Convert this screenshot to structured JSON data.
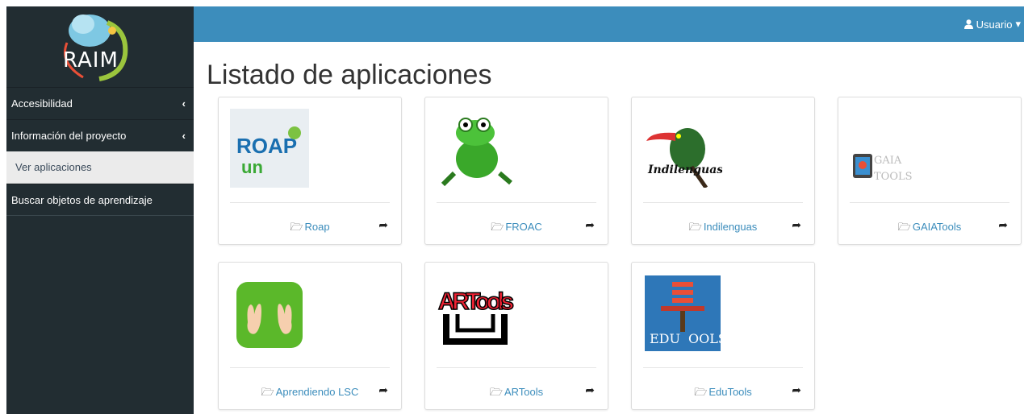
{
  "brand": {
    "logo_text": "RAIM"
  },
  "sidebar": {
    "items": [
      {
        "label": "Accesibilidad",
        "chevron": "‹"
      },
      {
        "label": "Información del proyecto",
        "chevron": "‹"
      },
      {
        "label": "Ver aplicaciones",
        "active": true
      },
      {
        "label": "Buscar objetos de aprendizaje"
      }
    ]
  },
  "header": {
    "user_label": "Usuario",
    "user_icon": "user-icon",
    "caret": "▾"
  },
  "main": {
    "title": "Listado de aplicaciones",
    "apps": [
      {
        "name": "Roap",
        "logo_text": "ROAP un"
      },
      {
        "name": "FROAC",
        "logo_text": ""
      },
      {
        "name": "Indilenguas",
        "logo_text": "Indilenguas"
      },
      {
        "name": "GAIATools",
        "logo_text": "GAIA TOOLS"
      },
      {
        "name": "Aprendiendo LSC",
        "logo_text": ""
      },
      {
        "name": "ARTools",
        "logo_text": "ARTools"
      },
      {
        "name": "EduTools",
        "logo_text": "EDU TOOLS"
      }
    ]
  },
  "colors": {
    "sidebar_bg": "#222d32",
    "topbar_bg": "#3c8dbc",
    "link": "#3c8dbc"
  }
}
